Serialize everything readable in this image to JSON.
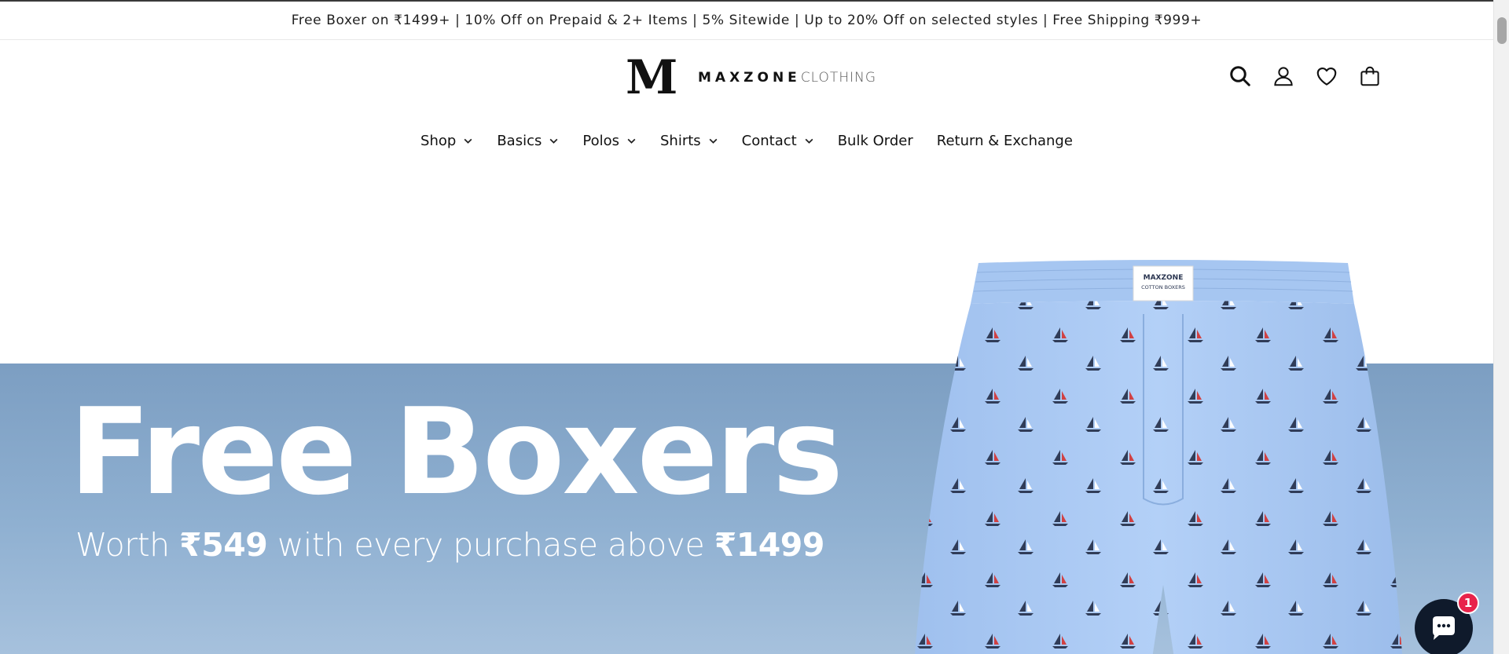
{
  "announcement": {
    "text": "Free Boxer on ₹1499+ | 10% Off on Prepaid & 2+ Items | 5% Sitewide | Up to 20% Off on selected styles | Free Shipping ₹999+"
  },
  "logo": {
    "mark": "M",
    "brand": "MAXZONE",
    "suffix": "CLOTHING"
  },
  "header_icons": [
    "search-icon",
    "account-icon",
    "wishlist-icon",
    "cart-icon"
  ],
  "nav": {
    "items": [
      {
        "label": "Shop",
        "dropdown": true
      },
      {
        "label": "Basics",
        "dropdown": true
      },
      {
        "label": "Polos",
        "dropdown": true
      },
      {
        "label": "Shirts",
        "dropdown": true
      },
      {
        "label": "Contact",
        "dropdown": true
      },
      {
        "label": "Bulk Order",
        "dropdown": false
      },
      {
        "label": "Return & Exchange",
        "dropdown": false
      }
    ]
  },
  "hero": {
    "title": "Free Boxers",
    "sub_prefix": "Worth ",
    "sub_price": "₹549",
    "sub_middle": " with every purchase above ",
    "sub_threshold": "₹1499",
    "product_label_brand": "MAXZONE",
    "product_label_line": "COTTON BOXERS",
    "colors": {
      "band": "#8fb0d1",
      "boxers": "#a9c9f2"
    }
  },
  "chat": {
    "badge_count": "1"
  }
}
